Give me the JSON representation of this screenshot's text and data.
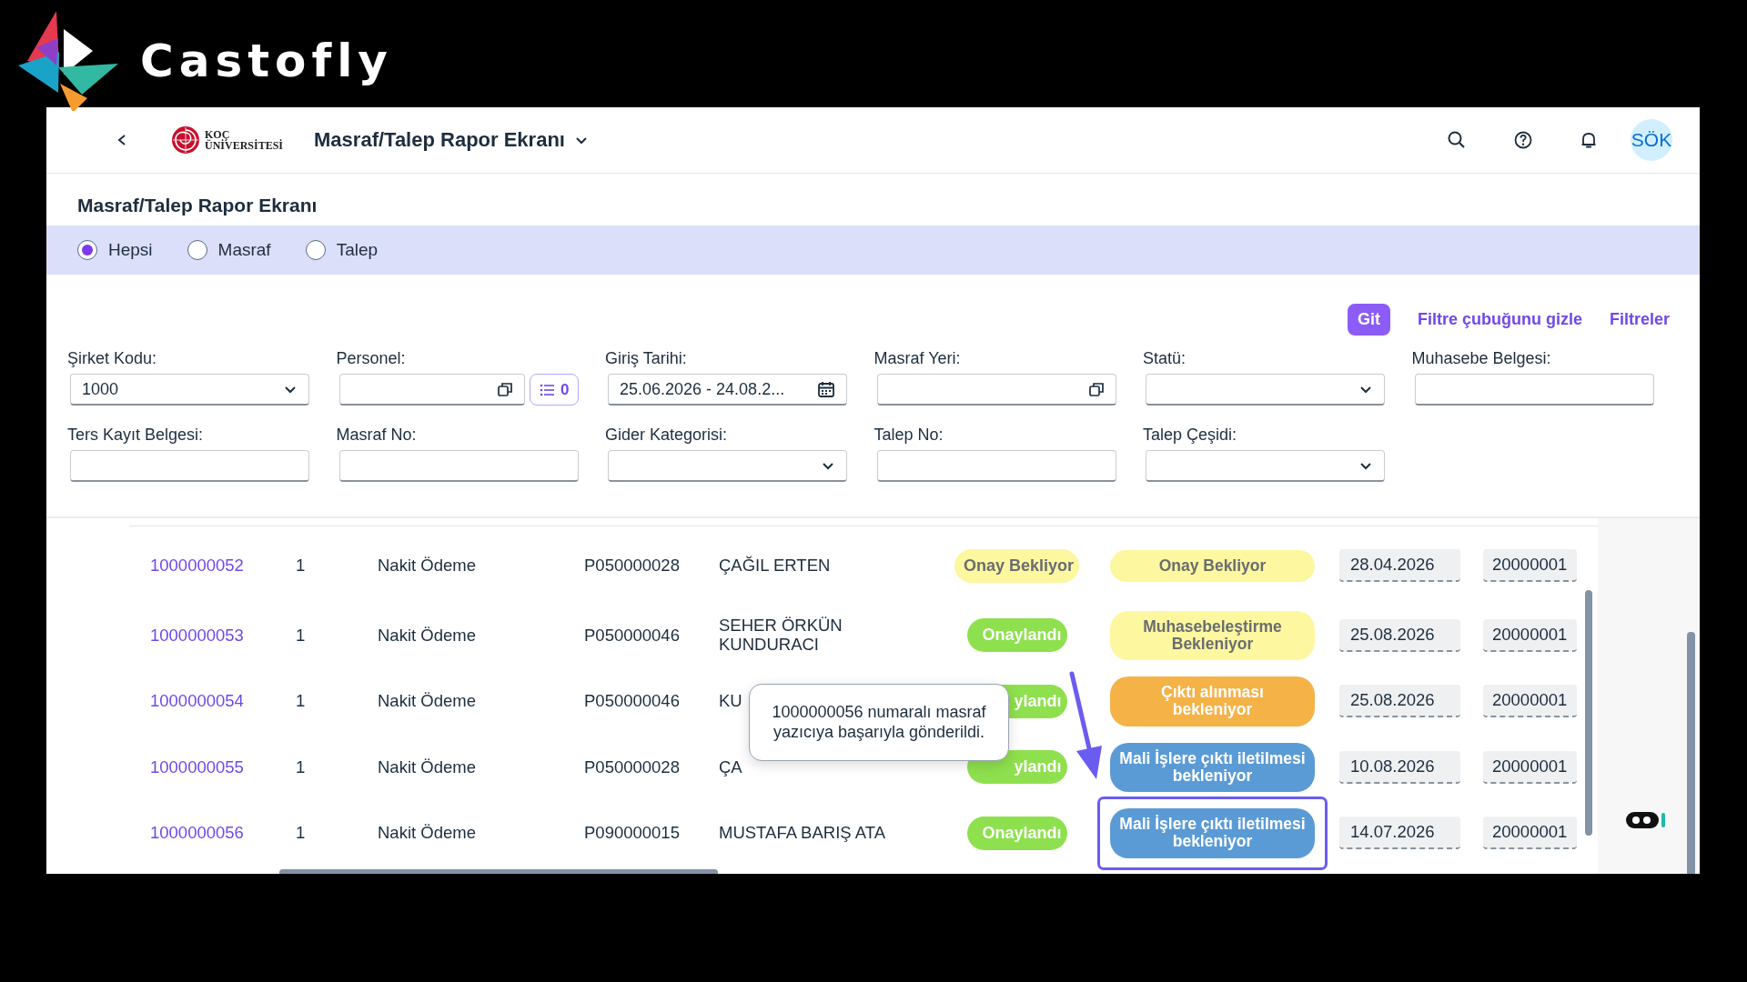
{
  "brand": {
    "name": "Castofly"
  },
  "header": {
    "logo_lines": [
      "KOÇ",
      "ÜNİVERSİTESİ"
    ],
    "title": "Masraf/Talep Rapor Ekranı",
    "avatar": "SÖK"
  },
  "page_title": "Masraf/Talep Rapor Ekranı",
  "radios": [
    {
      "label": "Hepsi",
      "selected": true
    },
    {
      "label": "Masraf",
      "selected": false
    },
    {
      "label": "Talep",
      "selected": false
    }
  ],
  "actions": {
    "go": "Git",
    "links": [
      "Filtre çubuğunu gizle",
      "Filtreler"
    ]
  },
  "filters": [
    {
      "label": "Şirket Kodu:",
      "kind": "select",
      "value": "1000"
    },
    {
      "label": "Personel:",
      "kind": "valuehelp",
      "count": "0"
    },
    {
      "label": "Giriş Tarihi:",
      "kind": "date",
      "value": "25.06.2026 - 24.08.2..."
    },
    {
      "label": "Masraf Yeri:",
      "kind": "valuehelp"
    },
    {
      "label": "Statü:",
      "kind": "select"
    },
    {
      "label": "Muhasebe Belgesi:",
      "kind": "text"
    },
    {
      "label": "Ters Kayıt Belgesi:",
      "kind": "text"
    },
    {
      "label": "Masraf No:",
      "kind": "text"
    },
    {
      "label": "Gider Kategorisi:",
      "kind": "select"
    },
    {
      "label": "Talep No:",
      "kind": "text"
    },
    {
      "label": "Talep Çeşidi:",
      "kind": "select"
    }
  ],
  "table": {
    "rows": [
      {
        "column_1": "1000000052",
        "column_2": "1",
        "column_3": "Nakit Ödeme",
        "column_4": "P050000028",
        "column_5": "ÇAĞIL ERTEN",
        "column_6": {
          "text": "Onay Bekliyor",
          "kind": "pending"
        },
        "column_7": {
          "text": "Onay Bekliyor",
          "kind": "pending",
          "highlighted": false
        },
        "column_8": "28.04.2026",
        "column_9": "20000001"
      },
      {
        "column_1": "1000000053",
        "column_2": "1",
        "column_3": "Nakit Ödeme",
        "column_4": "P050000046",
        "column_5": "SEHER ÖRKÜN KUNDURACI",
        "column_6": {
          "text": "Onaylandı",
          "kind": "approved"
        },
        "column_7": {
          "text": "Muhasebeleştirme Bekleniyor",
          "kind": "pending",
          "highlighted": false
        },
        "column_8": "25.08.2026",
        "column_9": "20000001"
      },
      {
        "column_1": "1000000054",
        "column_2": "1",
        "column_3": "Nakit Ödeme",
        "column_4": "P050000046",
        "column_5": "KU",
        "column_6": {
          "text": "ylandı",
          "kind": "approved"
        },
        "column_7": {
          "text": "Çıktı alınması bekleniyor",
          "kind": "print",
          "highlighted": false
        },
        "column_8": "25.08.2026",
        "column_9": "20000001"
      },
      {
        "column_1": "1000000055",
        "column_2": "1",
        "column_3": "Nakit Ödeme",
        "column_4": "P050000028",
        "column_5": "ÇA",
        "column_6": {
          "text": "ylandı",
          "kind": "approved"
        },
        "column_7": {
          "text": "Mali İşlere çıktı iletilmesi bekleniyor",
          "kind": "send",
          "highlighted": false
        },
        "column_8": "10.08.2026",
        "column_9": "20000001"
      },
      {
        "column_1": "1000000056",
        "column_2": "1",
        "column_3": "Nakit Ödeme",
        "column_4": "P090000015",
        "column_5": "MUSTAFA BARIŞ ATA",
        "column_6": {
          "text": "Onaylandı",
          "kind": "approved"
        },
        "column_7": {
          "text": "Mali İşlere çıktı iletilmesi bekleniyor",
          "kind": "send",
          "highlighted": true
        },
        "column_8": "14.07.2026",
        "column_9": "20000001"
      }
    ]
  },
  "toast": {
    "message": "1000000056 numaralı masraf yazıcıya başarıyla gönderildi."
  }
}
